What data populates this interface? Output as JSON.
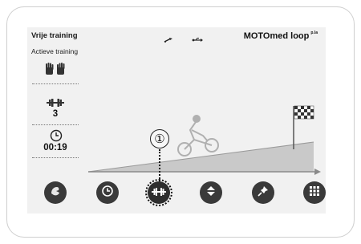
{
  "header": {
    "mode_title": "Vrije training",
    "mode_subtitle": "Actieve training",
    "brand": "MOTOmed loop",
    "brand_sup": "p.la"
  },
  "side_panel": {
    "hands_icon": "hands-icon",
    "resistance_icon": "dumbbell-icon",
    "resistance_value": "3",
    "time_icon": "clock-icon",
    "time_value": "00:19"
  },
  "callout": {
    "number": "①"
  },
  "toolbar": {
    "buttons": [
      "hand-pedal-icon",
      "clock-icon",
      "dumbbell-icon",
      "up-down-icon",
      "pin-icon",
      "grid-icon"
    ]
  },
  "colors": {
    "screen_bg": "#f1f1f1",
    "button": "#3a3a3a",
    "ramp": "#c9c9c9"
  }
}
